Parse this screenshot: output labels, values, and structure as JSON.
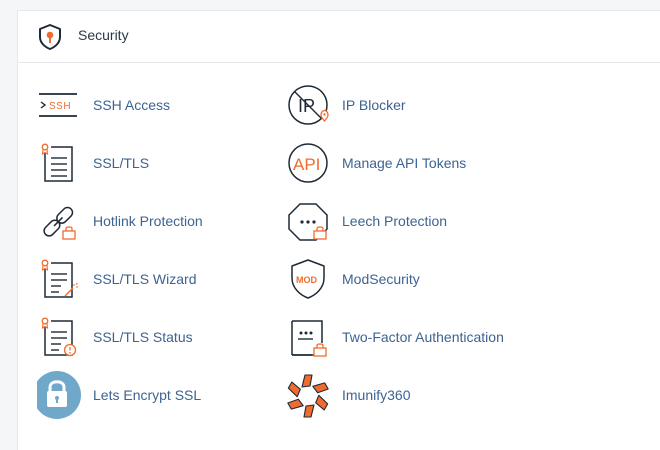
{
  "section": {
    "title": "Security",
    "icon": "shield-icon"
  },
  "colors": {
    "link": "#3d6391",
    "icon_dark": "#1f2a36",
    "icon_accent": "#f06c2e",
    "lets_encrypt_bg": "#6fa8c9"
  },
  "tools": [
    {
      "id": "ssh-access",
      "label": "SSH Access",
      "icon": "ssh-terminal-icon"
    },
    {
      "id": "ip-blocker",
      "label": "IP Blocker",
      "icon": "ip-blocker-icon",
      "icon_text": "IP"
    },
    {
      "id": "ssl-tls",
      "label": "SSL/TLS",
      "icon": "certificate-icon"
    },
    {
      "id": "manage-api-tokens",
      "label": "Manage API Tokens",
      "icon": "api-token-icon",
      "icon_text": "API"
    },
    {
      "id": "hotlink-protection",
      "label": "Hotlink Protection",
      "icon": "chain-link-lock-icon"
    },
    {
      "id": "leech-protection",
      "label": "Leech Protection",
      "icon": "leech-protection-icon"
    },
    {
      "id": "ssl-tls-wizard",
      "label": "SSL/TLS Wizard",
      "icon": "certificate-wand-icon"
    },
    {
      "id": "modsecurity",
      "label": "ModSecurity",
      "icon": "mod-shield-icon",
      "icon_text": "MOD"
    },
    {
      "id": "ssl-tls-status",
      "label": "SSL/TLS Status",
      "icon": "certificate-status-icon"
    },
    {
      "id": "two-factor-authentication",
      "label": "Two-Factor Authentication",
      "icon": "two-factor-icon"
    },
    {
      "id": "lets-encrypt-ssl",
      "label": "Lets Encrypt SSL",
      "icon": "padlock-icon"
    },
    {
      "id": "imunify360",
      "label": "Imunify360",
      "icon": "imunify360-icon"
    }
  ]
}
